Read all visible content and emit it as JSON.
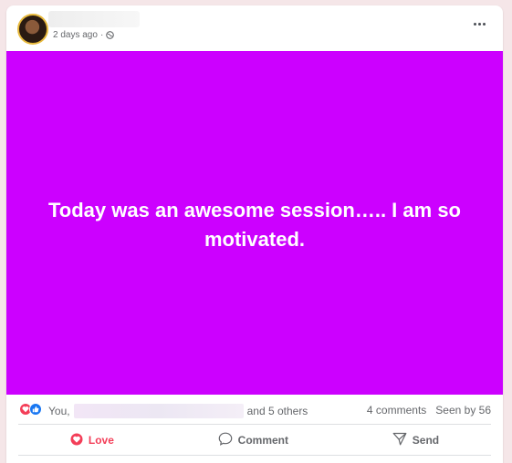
{
  "post": {
    "time": "2 days ago",
    "separator": "·",
    "text": "Today was an awesome session….. I am so motivated.",
    "background_color": "#cc00ff"
  },
  "reactions": {
    "prefix": "You,",
    "suffix": "and 5 others",
    "comments": "4 comments",
    "seen": "Seen by 56"
  },
  "actions": {
    "love": "Love",
    "comment": "Comment",
    "send": "Send"
  },
  "icons": {
    "globe": "globe-icon",
    "more": "more-options-icon",
    "love_reaction": "love-reaction-icon",
    "like_reaction": "like-reaction-icon",
    "comment": "comment-icon",
    "send": "send-icon"
  },
  "colors": {
    "accent_love": "#f33e58",
    "accent_like": "#1877f2"
  }
}
